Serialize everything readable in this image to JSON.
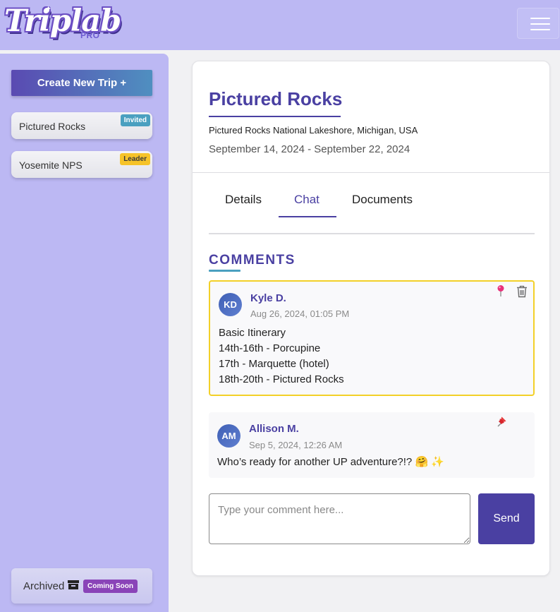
{
  "header": {
    "logo_text": "Triplab",
    "logo_sub": "PRO",
    "menu_icon": "hamburger-icon"
  },
  "sidebar": {
    "create_label": "Create New Trip +",
    "trips": [
      {
        "label": "Pictured Rocks",
        "badge": "Invited",
        "badge_color": "#4aa0c0"
      },
      {
        "label": "Yosemite NPS",
        "badge": "Leader",
        "badge_color": "#f6c329"
      }
    ],
    "archived_label": "Archived",
    "archived_icon": "archive-box-icon",
    "archived_badge": "Coming Soon"
  },
  "trip": {
    "title": "Pictured Rocks",
    "location": "Pictured Rocks National Lakeshore, Michigan, USA",
    "dates": "September 14, 2024 - September 22, 2024"
  },
  "tabs": [
    {
      "label": "Details",
      "active": false
    },
    {
      "label": "Chat",
      "active": true
    },
    {
      "label": "Documents",
      "active": false
    }
  ],
  "comments_heading": "COMMENTS",
  "comments": [
    {
      "initials": "KD",
      "author": "Kyle D.",
      "time": "Aug 26, 2024, 01:05 PM",
      "lines": [
        "Basic Itinerary",
        "14th-16th - Porcupine",
        "17th - Marquette (hotel)",
        "18th-20th - Pictured Rocks"
      ],
      "pinned": true,
      "pin_icon": "round-pushpin-icon",
      "can_delete": true
    },
    {
      "initials": "AM",
      "author": "Allison M.",
      "time": "Sep 5, 2024, 12:26 AM",
      "lines": [
        "Who’s ready for another UP adventure?!? 🤗 ✨"
      ],
      "pinned": false,
      "pin_icon": "pushpin-icon",
      "can_delete": false
    }
  ],
  "composer": {
    "placeholder": "Type your comment here...",
    "send_label": "Send"
  },
  "colors": {
    "brand_purple": "#4a40a2",
    "sidebar_bg": "#bcb8f3",
    "pinned_border": "#f3d028",
    "accent_teal": "#4aa0c0"
  }
}
